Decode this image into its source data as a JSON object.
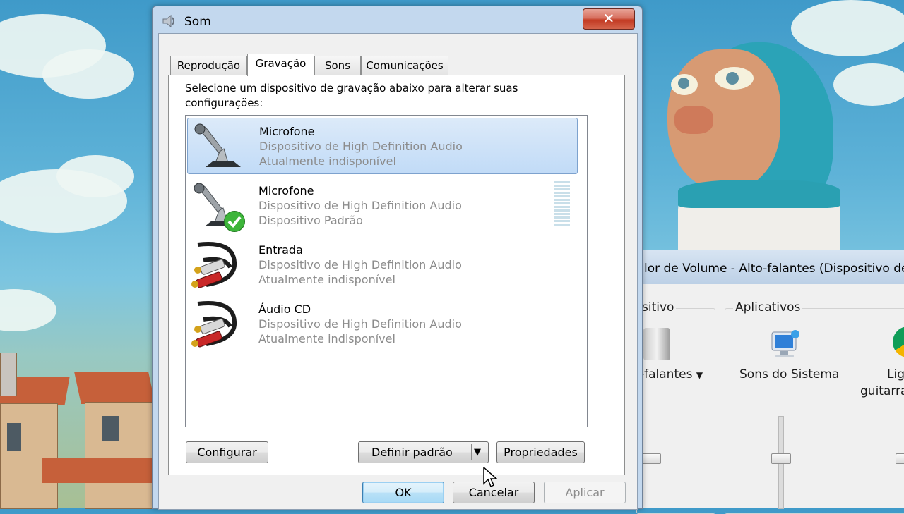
{
  "window": {
    "title": "Som",
    "close_glyph": "✕"
  },
  "tabs": [
    {
      "label": "Reprodução",
      "active": false
    },
    {
      "label": "Gravação",
      "active": true
    },
    {
      "label": "Sons",
      "active": false
    },
    {
      "label": "Comunicações",
      "active": false
    }
  ],
  "instruction": "Selecione um dispositivo de gravação abaixo para alterar suas configurações:",
  "devices": [
    {
      "name": "Microfone",
      "line1": "Dispositivo de High Definition Audio",
      "line2": "Atualmente indisponível",
      "icon": "microphone-icon",
      "selected": true
    },
    {
      "name": "Microfone",
      "line1": "Dispositivo de High Definition Audio",
      "line2": "Dispositivo Padrão",
      "icon": "microphone-icon",
      "default_check": true
    },
    {
      "name": "Entrada",
      "line1": "Dispositivo de High Definition Audio",
      "line2": "Atualmente indisponível",
      "icon": "rca-cable-icon"
    },
    {
      "name": "Áudio CD",
      "line1": "Dispositivo de High Definition Audio",
      "line2": "Atualmente indisponível",
      "icon": "rca-cable-icon"
    }
  ],
  "buttons": {
    "configure": "Configurar",
    "set_default": "Definir padrão",
    "properties": "Propriedades",
    "ok": "OK",
    "cancel": "Cancelar",
    "apply": "Aplicar"
  },
  "mixer": {
    "title": "lor de Volume - Alto-falantes (Dispositivo de",
    "device_group": "sitivo",
    "apps_group": "Aplicativos",
    "device_label": "-falantes",
    "system_sounds": "Sons do Sistema",
    "app3_line1": "Lig",
    "app3_line2": "guitarra"
  },
  "colors": {
    "selection": "#c1dbf7",
    "close_button": "#c23a23",
    "default_check": "#3db53a"
  }
}
